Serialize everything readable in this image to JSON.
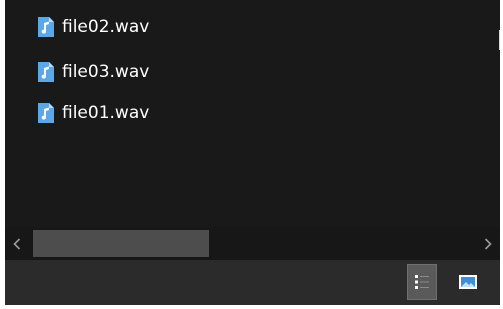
{
  "files": [
    {
      "name": "file02.wav",
      "icon": "music-note-icon"
    },
    {
      "name": "file03.wav",
      "icon": "music-note-icon"
    },
    {
      "name": "file01.wav",
      "icon": "music-note-icon"
    }
  ],
  "scrollbar": {
    "left_icon": "chevron-left-icon",
    "right_icon": "chevron-right-icon",
    "thumb_position_fraction": 0.0,
    "thumb_size_fraction": 0.4
  },
  "status_bar": {
    "details_view_icon": "details-view-icon",
    "details_view_selected": true,
    "large_icons_view_icon": "large-icons-view-icon"
  },
  "colors": {
    "background": "#191919",
    "text": "#ffffff",
    "status_bar": "#2b2b2b",
    "scroll_thumb": "#4d4d4d",
    "selected_view": "#5a5a5a",
    "file_icon": "#4da3e8"
  }
}
